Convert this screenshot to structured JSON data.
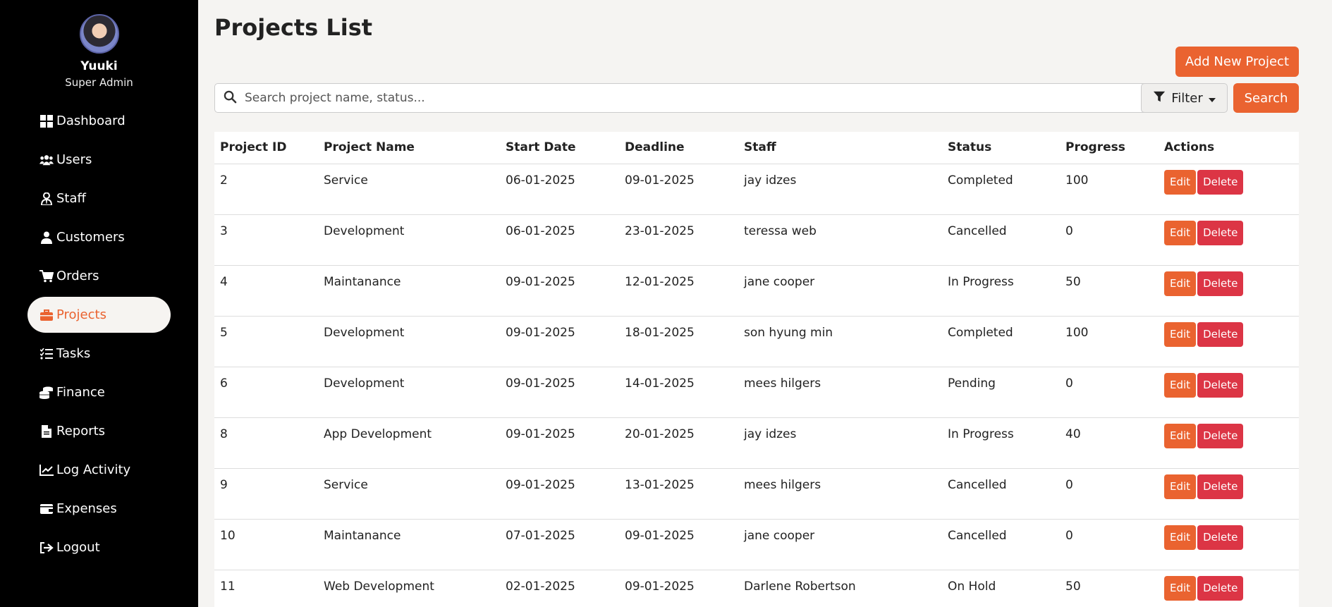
{
  "sidebar": {
    "user_name": "Yuuki",
    "user_role": "Super Admin",
    "items": [
      {
        "label": "Dashboard",
        "icon": "dashboard-icon",
        "active": false
      },
      {
        "label": "Users",
        "icon": "users-icon",
        "active": false
      },
      {
        "label": "Staff",
        "icon": "staff-icon",
        "active": false
      },
      {
        "label": "Customers",
        "icon": "customer-icon",
        "active": false
      },
      {
        "label": "Orders",
        "icon": "cart-icon",
        "active": false
      },
      {
        "label": "Projects",
        "icon": "briefcase-icon",
        "active": true
      },
      {
        "label": "Tasks",
        "icon": "tasks-icon",
        "active": false
      },
      {
        "label": "Finance",
        "icon": "coins-icon",
        "active": false
      },
      {
        "label": "Reports",
        "icon": "file-icon",
        "active": false
      },
      {
        "label": "Log Activity",
        "icon": "chart-line-icon",
        "active": false
      },
      {
        "label": "Expenses",
        "icon": "wallet-icon",
        "active": false
      },
      {
        "label": "Logout",
        "icon": "logout-icon",
        "active": false
      }
    ]
  },
  "page": {
    "title": "Projects List",
    "add_button": "Add New Project",
    "search_placeholder": "Search project name, status...",
    "filter_label": "Filter",
    "search_button": "Search"
  },
  "table": {
    "headers": [
      "Project ID",
      "Project Name",
      "Start Date",
      "Deadline",
      "Staff",
      "Status",
      "Progress",
      "Actions"
    ],
    "edit_label": "Edit",
    "delete_label": "Delete",
    "rows": [
      [
        "2",
        "Service",
        "06-01-2025",
        "09-01-2025",
        "jay idzes",
        "Completed",
        "100"
      ],
      [
        "3",
        "Development",
        "06-01-2025",
        "23-01-2025",
        "teressa web",
        "Cancelled",
        "0"
      ],
      [
        "4",
        "Maintanance",
        "09-01-2025",
        "12-01-2025",
        "jane cooper",
        "In Progress",
        "50"
      ],
      [
        "5",
        "Development",
        "09-01-2025",
        "18-01-2025",
        "son hyung min",
        "Completed",
        "100"
      ],
      [
        "6",
        "Development",
        "09-01-2025",
        "14-01-2025",
        "mees hilgers",
        "Pending",
        "0"
      ],
      [
        "8",
        "App Development",
        "09-01-2025",
        "20-01-2025",
        "jay idzes",
        "In Progress",
        "40"
      ],
      [
        "9",
        "Service",
        "09-01-2025",
        "13-01-2025",
        "mees hilgers",
        "Cancelled",
        "0"
      ],
      [
        "10",
        "Maintanance",
        "07-01-2025",
        "09-01-2025",
        "jane cooper",
        "Cancelled",
        "0"
      ],
      [
        "11",
        "Web Development",
        "02-01-2025",
        "09-01-2025",
        "Darlene Robertson",
        "On Hold",
        "50"
      ]
    ]
  },
  "colors": {
    "accent": "#ea6330",
    "danger": "#dc3545",
    "sidebar_bg": "#000000",
    "page_bg": "#f5f4f2"
  }
}
